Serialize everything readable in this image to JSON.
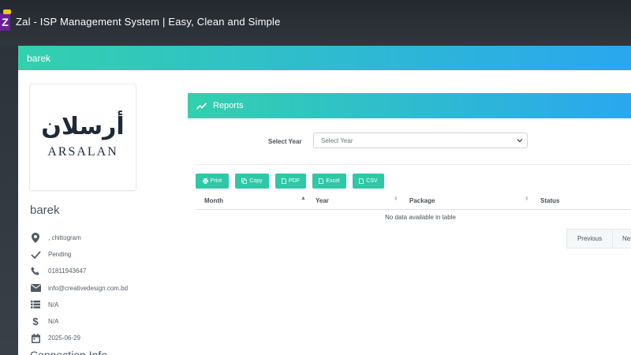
{
  "window": {
    "app_icon_letter": "Z",
    "title": "Zal - ISP Management System | Easy, Clean and Simple"
  },
  "card": {
    "header_title": "barek"
  },
  "profile": {
    "logo_arabic": "أرسلان",
    "logo_latin": "ARSALAN",
    "name": "barek",
    "details": [
      {
        "icon": "map-pin-icon",
        "text": ", chittogram"
      },
      {
        "icon": "check-icon",
        "text": "Pending"
      },
      {
        "icon": "phone-icon",
        "text": "01811943647"
      },
      {
        "icon": "envelope-icon",
        "text": "info@creativedesign.com.bd"
      },
      {
        "icon": "list-icon",
        "text": "N/A"
      },
      {
        "icon": "dollar-icon",
        "text": "N/A"
      },
      {
        "icon": "calendar-icon",
        "text": "2025-06-29"
      }
    ],
    "next_section_heading": "Connection Info"
  },
  "reports": {
    "title": "Reports",
    "year_label": "Select Year",
    "year_select_value": "Select Year",
    "buttons": {
      "print": "Print",
      "copy": "Copy",
      "pdf": "PDF",
      "excel": "Excel",
      "csv": "CSV"
    },
    "columns": [
      "Month",
      "Year",
      "Package",
      "Status"
    ],
    "empty_message": "No data available in table",
    "pagination": {
      "previous": "Previous",
      "next": "Next"
    }
  },
  "colors": {
    "accent_teal": "#33d0ae",
    "accent_blue": "#2aa7ef",
    "button_teal": "#2ec8a6"
  }
}
